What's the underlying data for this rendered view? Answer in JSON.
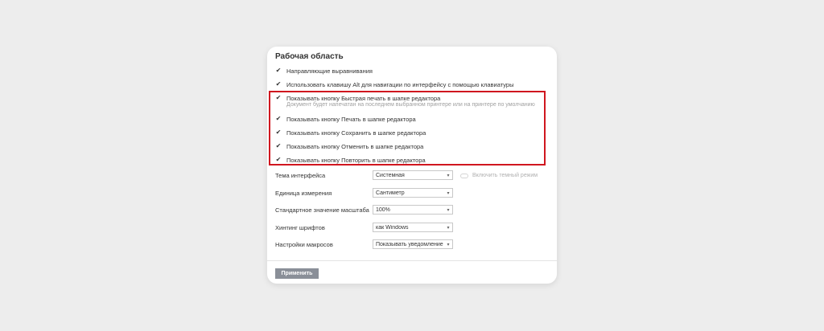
{
  "section_title": "Рабочая область",
  "checkboxes": [
    {
      "label": "Направляющие выравнивания",
      "checked": true
    },
    {
      "label": "Использовать клавишу Alt для навигации по интерфейсу с помощью клавиатуры",
      "checked": true
    },
    {
      "label": "Показывать кнопку Быстрая печать в шапке редактора",
      "checked": true
    },
    {
      "label": "Показывать кнопку Печать в шапке редактора",
      "checked": true
    },
    {
      "label": "Показывать кнопку Сохранить в шапке редактора",
      "checked": true
    },
    {
      "label": "Показывать кнопку Отменить в шапке редактора",
      "checked": true
    },
    {
      "label": "Показывать кнопку Повторить в шапке редактора",
      "checked": true
    }
  ],
  "quick_print_hint": "Документ будет напечатан на последнем выбранном принтере или на принтере по умолчанию",
  "settings": [
    {
      "label": "Тема интерфейса",
      "value": "Системная"
    },
    {
      "label": "Единица измерения",
      "value": "Сантиметр"
    },
    {
      "label": "Стандартное значение масштаба",
      "value": "100%"
    },
    {
      "label": "Хинтинг шрифтов",
      "value": "как Windows"
    },
    {
      "label": "Настройки макросов",
      "value": "Показывать уведомление"
    }
  ],
  "dark_mode_toggle_label": "Включить темный режим",
  "apply_label": "Применить",
  "icons": {
    "check": "checkmark-icon",
    "dropdown": "chevron-down-icon"
  },
  "colors": {
    "highlight": "#d0161f",
    "apply_button": "#8a8f98",
    "background": "#ededed"
  }
}
